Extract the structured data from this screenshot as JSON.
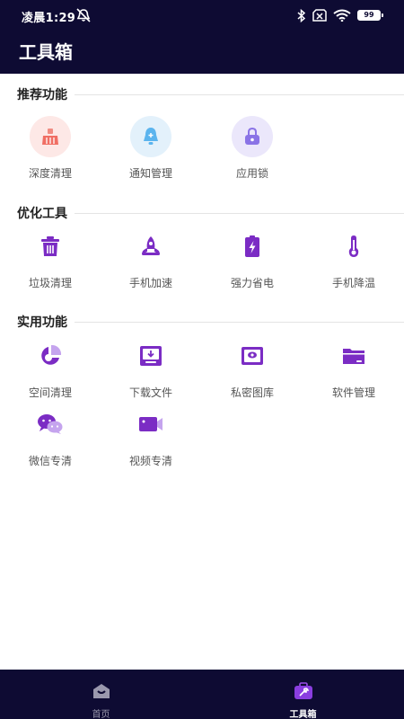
{
  "status": {
    "time": "凌晨1:29",
    "battery": "99"
  },
  "header": {
    "title": "工具箱"
  },
  "sections": [
    {
      "title": "推荐功能",
      "items": [
        {
          "label": "深度清理",
          "icon": "broom-icon"
        },
        {
          "label": "通知管理",
          "icon": "bell-icon"
        },
        {
          "label": "应用锁",
          "icon": "lock-icon"
        }
      ]
    },
    {
      "title": "优化工具",
      "items": [
        {
          "label": "垃圾清理",
          "icon": "trash-icon"
        },
        {
          "label": "手机加速",
          "icon": "rocket-icon"
        },
        {
          "label": "强力省电",
          "icon": "battery-icon"
        },
        {
          "label": "手机降温",
          "icon": "thermometer-icon"
        }
      ]
    },
    {
      "title": "实用功能",
      "items": [
        {
          "label": "空间清理",
          "icon": "pie-chart-icon"
        },
        {
          "label": "下载文件",
          "icon": "download-icon"
        },
        {
          "label": "私密图库",
          "icon": "gallery-icon"
        },
        {
          "label": "软件管理",
          "icon": "folder-icon"
        },
        {
          "label": "微信专清",
          "icon": "wechat-icon"
        },
        {
          "label": "视频专清",
          "icon": "video-icon"
        }
      ]
    }
  ],
  "tabbar": {
    "items": [
      {
        "label": "首页",
        "icon": "home-icon",
        "active": false
      },
      {
        "label": "工具箱",
        "icon": "toolbox-icon",
        "active": true
      }
    ]
  },
  "colors": {
    "header_bg": "#0e0b33",
    "accent": "#7b2cc4",
    "inactive_tab": "#9a98ad"
  }
}
